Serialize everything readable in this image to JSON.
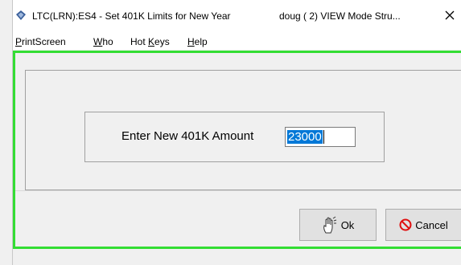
{
  "window": {
    "title": "LTC(LRN):ES4 - Set 401K Limits for New Year",
    "title_right": "doug  ( 2)  VIEW  Mode  Stru..."
  },
  "menu": {
    "items": [
      {
        "underline": "P",
        "rest": "rintScreen"
      },
      {
        "underline": "W",
        "rest": "ho"
      },
      {
        "prefix": "Hot ",
        "underline": "K",
        "rest": "eys"
      },
      {
        "underline": "H",
        "rest": "elp"
      }
    ]
  },
  "form": {
    "label": "Enter New 401K Amount",
    "value": "23000"
  },
  "buttons": {
    "ok": "Ok",
    "cancel": "Cancel"
  },
  "colors": {
    "highlight": "#33dd33",
    "selection": "#0078d7",
    "cancel_icon": "#e01010"
  },
  "icons": [
    "app-icon",
    "close-icon",
    "hand-icon",
    "no-entry-icon"
  ]
}
